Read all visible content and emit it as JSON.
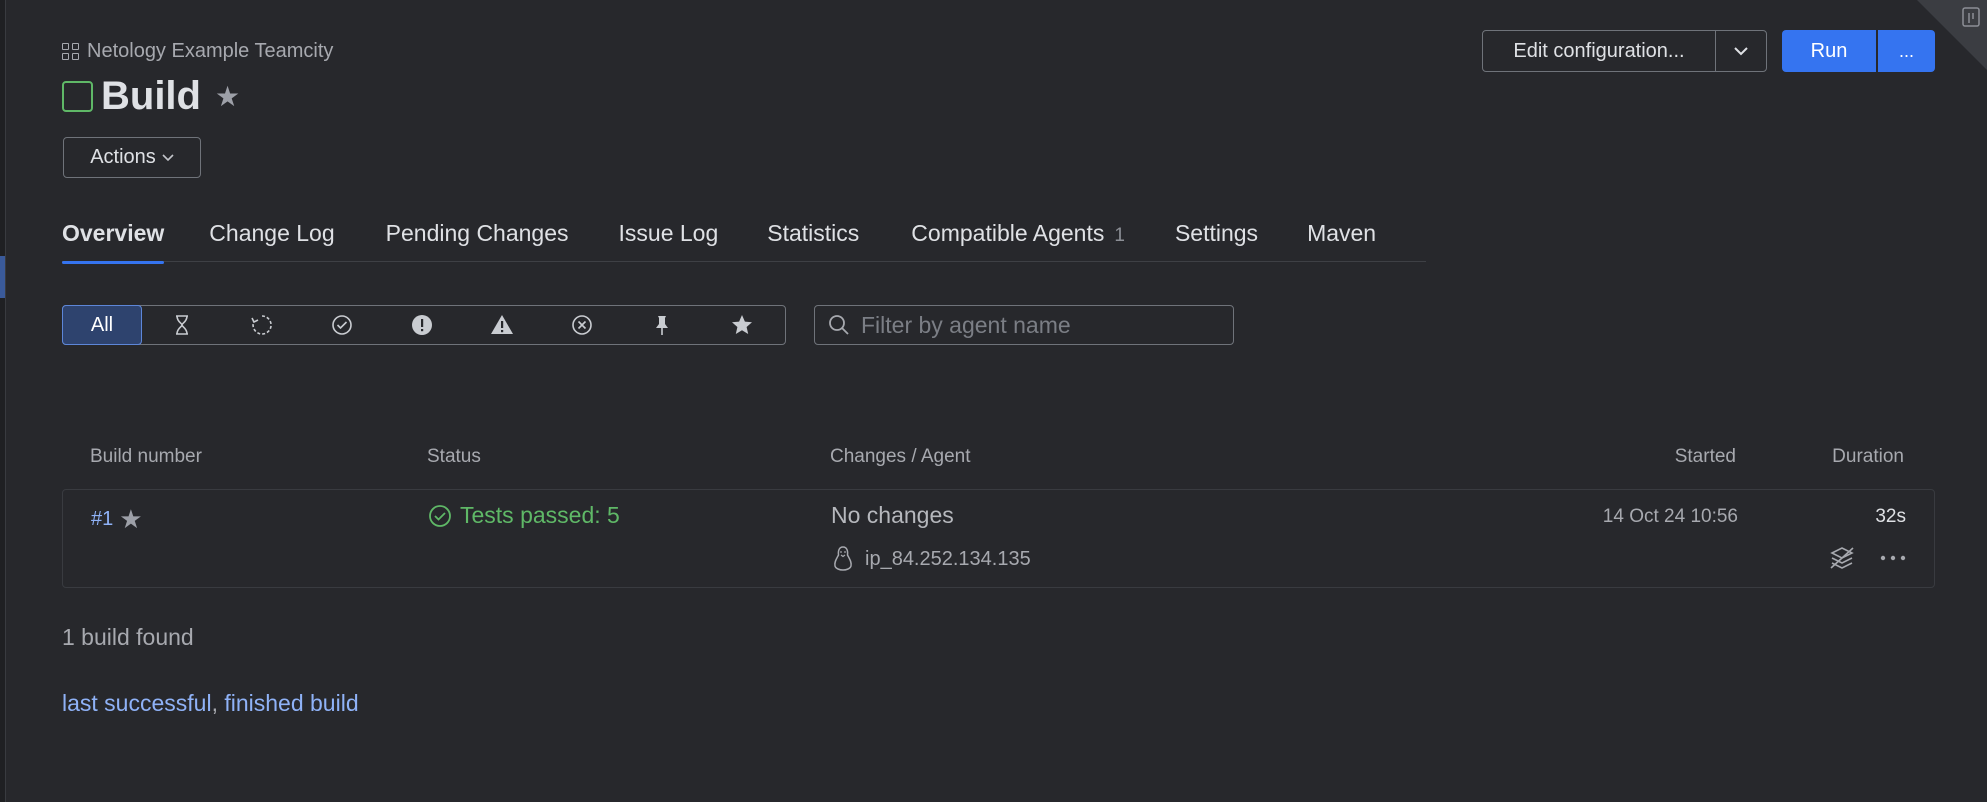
{
  "breadcrumb": {
    "project": "Netology Example Teamcity"
  },
  "header": {
    "title": "Build",
    "actions_label": "Actions"
  },
  "toolbar": {
    "edit_label": "Edit configuration...",
    "run_label": "Run",
    "more_label": "..."
  },
  "tabs": [
    {
      "label": "Overview",
      "active": true
    },
    {
      "label": "Change Log"
    },
    {
      "label": "Pending Changes"
    },
    {
      "label": "Issue Log"
    },
    {
      "label": "Statistics"
    },
    {
      "label": "Compatible Agents",
      "count": "1"
    },
    {
      "label": "Settings"
    },
    {
      "label": "Maven"
    }
  ],
  "filters": {
    "all_label": "All",
    "icons": [
      "hourglass-icon",
      "running-icon",
      "success-icon",
      "failed-icon",
      "warning-icon",
      "cancelled-icon",
      "pin-icon",
      "star-icon"
    ]
  },
  "search": {
    "placeholder": "Filter by agent name"
  },
  "table": {
    "headers": {
      "build_number": "Build number",
      "status": "Status",
      "changes": "Changes / Agent",
      "started": "Started",
      "duration": "Duration"
    },
    "rows": [
      {
        "number": "#1",
        "status": "Tests passed: 5",
        "changes": "No changes",
        "agent": "ip_84.252.134.135",
        "started": "14 Oct 24 10:56",
        "duration": "32s"
      }
    ]
  },
  "footer": {
    "found": "1 build found",
    "link_last_successful": "last successful",
    "separator": ",",
    "link_finished": "finished build"
  },
  "colors": {
    "background": "#27282c",
    "accent": "#3574f0",
    "success": "#5fb867",
    "link": "#8fb2f7"
  }
}
